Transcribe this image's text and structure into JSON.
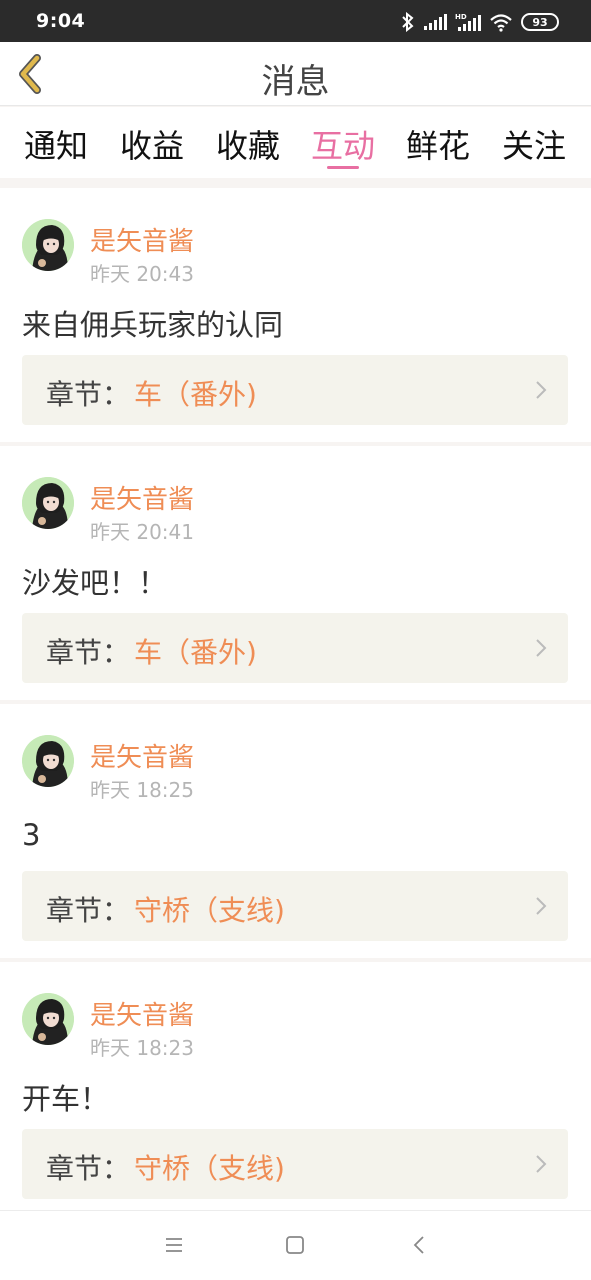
{
  "status_bar": {
    "time": "9:04",
    "battery": "93",
    "icons": [
      "bluetooth-icon",
      "signal-icon",
      "hd-signal-icon",
      "wifi-icon",
      "battery-icon"
    ]
  },
  "header": {
    "title": "消息",
    "back_icon": "chevron-left-icon",
    "back_color": "#e0b94d"
  },
  "tabs": [
    {
      "label": "通知",
      "active": false
    },
    {
      "label": "收益",
      "active": false
    },
    {
      "label": "收藏",
      "active": false
    },
    {
      "label": "互动",
      "active": true
    },
    {
      "label": "鲜花",
      "active": false
    },
    {
      "label": "关注",
      "active": false
    }
  ],
  "messages": [
    {
      "user": "是矢音酱",
      "time": "昨天 20:43",
      "text": "来自佣兵玩家的认同",
      "chapter_label": "章节：",
      "chapter_name": "车（番外)"
    },
    {
      "user": "是矢音酱",
      "time": "昨天 20:41",
      "text": "沙发吧！！",
      "chapter_label": "章节：",
      "chapter_name": "车（番外)"
    },
    {
      "user": "是矢音酱",
      "time": "昨天 18:25",
      "text": "3",
      "chapter_label": "章节：",
      "chapter_name": "守桥（支线)"
    },
    {
      "user": "是矢音酱",
      "time": "昨天 18:23",
      "text": "开车！",
      "chapter_label": "章节：",
      "chapter_name": "守桥（支线)"
    }
  ],
  "colors": {
    "accent": "#e86fa2",
    "username": "#ef8d55",
    "chapter_bg": "#f4f3ec",
    "avatar_bg": "#c6eab7"
  },
  "nav_bar": {
    "icons": [
      "menu-icon",
      "home-icon",
      "back-icon"
    ]
  }
}
